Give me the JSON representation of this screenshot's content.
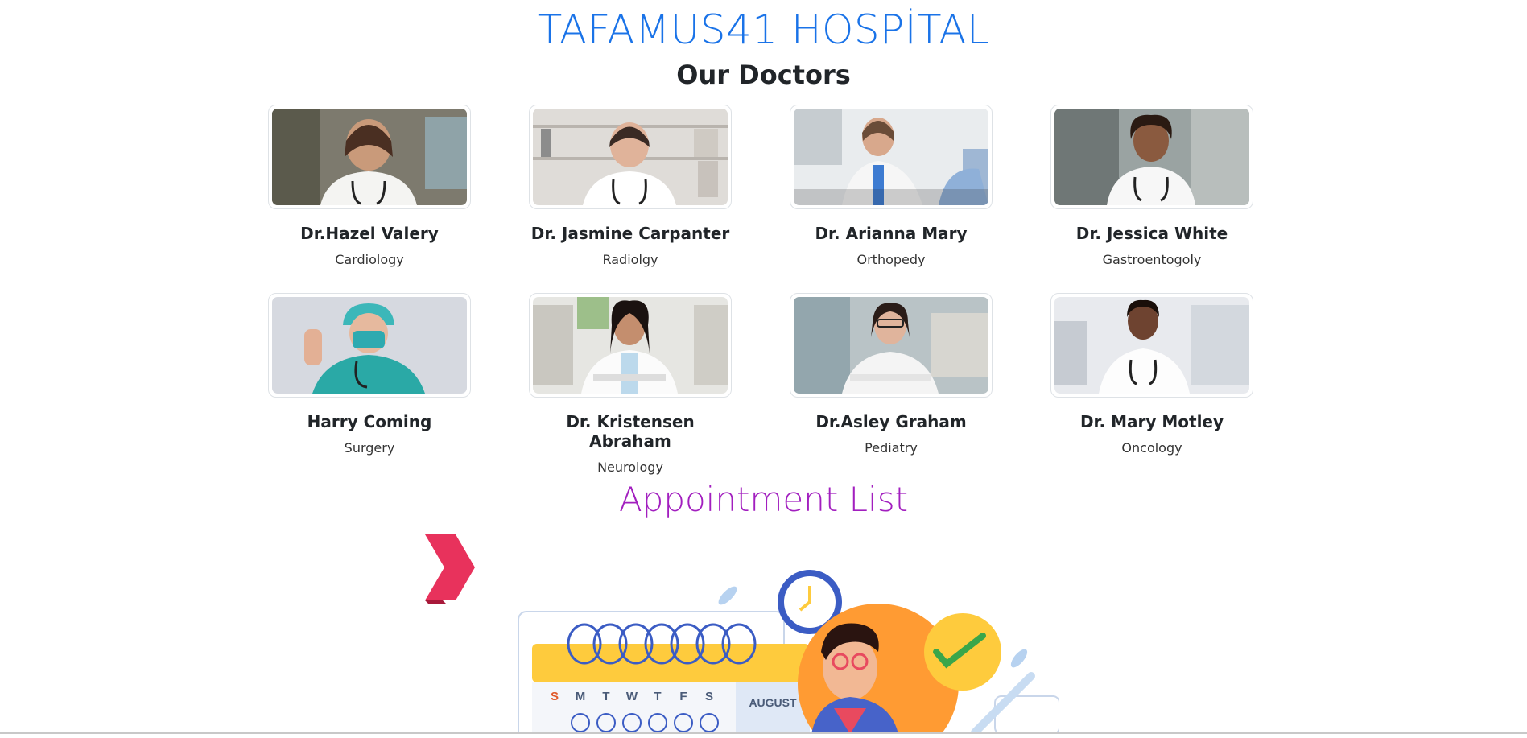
{
  "hospital": {
    "name": "TAFAMUS41 HOSPİTAL"
  },
  "doctors_section": {
    "title": "Our Doctors"
  },
  "doctors": [
    {
      "name": "Dr.Hazel Valery",
      "department": "Cardiology"
    },
    {
      "name": "Dr. Jasmine Carpanter",
      "department": "Radiolgy"
    },
    {
      "name": "Dr. Arianna Mary",
      "department": "Orthopedy"
    },
    {
      "name": "Dr. Jessica White",
      "department": "Gastroentogoly"
    },
    {
      "name": "Harry Coming",
      "department": "Surgery"
    },
    {
      "name": "Dr. Kristensen Abraham",
      "department": "Neurology"
    },
    {
      "name": "Dr.Asley Graham",
      "department": "Pediatry"
    },
    {
      "name": "Dr. Mary Motley",
      "department": "Oncology"
    }
  ],
  "appointments": {
    "title": "Appointment List",
    "calendar_month": "AUGUST",
    "weekdays": [
      "S",
      "M",
      "T",
      "W",
      "T",
      "F",
      "S"
    ]
  },
  "icons": {
    "next_arrow": "double-chevron-right-icon"
  },
  "colors": {
    "title_blue": "#1a73e8",
    "appointment_purple": "#a21fbf",
    "accent_red": "#e8325c"
  }
}
